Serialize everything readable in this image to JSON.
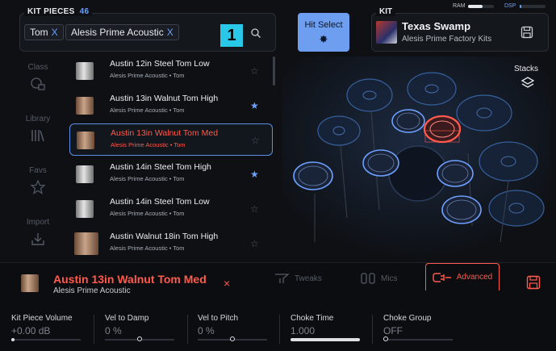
{
  "kit_pieces": {
    "title": "KIT PIECES",
    "count": "46",
    "filters": [
      {
        "label": "Tom",
        "remove": "X"
      },
      {
        "label": "Alesis Prime Acoustic",
        "remove": "X"
      }
    ],
    "badge": "1"
  },
  "hit_select": {
    "label": "Hit Select"
  },
  "kit": {
    "title": "KIT",
    "name": "Texas Swamp",
    "subtitle": "Alesis Prime Factory Kits"
  },
  "meters": {
    "ram_label": "RAM",
    "ram_level": 0.55,
    "dsp_label": "DSP",
    "dsp_level": 0.05
  },
  "sidebar": [
    {
      "label": "Class",
      "icon": "class-icon"
    },
    {
      "label": "Library",
      "icon": "library-icon"
    },
    {
      "label": "Favs",
      "icon": "star-icon"
    },
    {
      "label": "Import",
      "icon": "import-icon"
    }
  ],
  "list": [
    {
      "name": "Austin 12in Steel Tom Low",
      "sub": "Alesis Prime Acoustic • Tom",
      "fav": false,
      "selected": false
    },
    {
      "name": "Austin 13in Walnut Tom High",
      "sub": "Alesis Prime Acoustic • Tom",
      "fav": true,
      "selected": false
    },
    {
      "name": "Austin 13in Walnut Tom Med",
      "sub": "Alesis Prime Acoustic • Tom",
      "fav": false,
      "selected": true
    },
    {
      "name": "Austin 14in Steel Tom High",
      "sub": "Alesis Prime Acoustic • Tom",
      "fav": true,
      "selected": false
    },
    {
      "name": "Austin 14in Steel Tom Low",
      "sub": "Alesis Prime Acoustic • Tom",
      "fav": false,
      "selected": false
    },
    {
      "name": "Austin Walnut 18in Tom High",
      "sub": "Alesis Prime Acoustic • Tom",
      "fav": false,
      "selected": false
    }
  ],
  "stacks": {
    "label": "Stacks"
  },
  "selected_piece": {
    "name": "Austin 13in Walnut Tom Med",
    "sub": "Alesis Prime Acoustic",
    "close": "×"
  },
  "tabs": [
    {
      "label": "Tweaks",
      "icon": "tweaks-icon"
    },
    {
      "label": "Mics",
      "icon": "mics-icon"
    },
    {
      "label": "Advanced",
      "icon": "advanced-icon",
      "active": true
    }
  ],
  "params": [
    {
      "label": "Kit Piece Volume",
      "value": "+0.00 dB",
      "level": 0.0
    },
    {
      "label": "Vel to Damp",
      "value": "0 %",
      "level": 0.5
    },
    {
      "label": "Vel to Pitch",
      "value": "0 %",
      "level": 0.5
    },
    {
      "label": "Choke Time",
      "value": "1.000",
      "level": 1.0
    },
    {
      "label": "Choke Group",
      "value": "OFF",
      "level": 0.0
    }
  ],
  "colors": {
    "accent": "#6ea0ff",
    "highlight": "#ff5a4c",
    "badge": "#29c8e8"
  }
}
